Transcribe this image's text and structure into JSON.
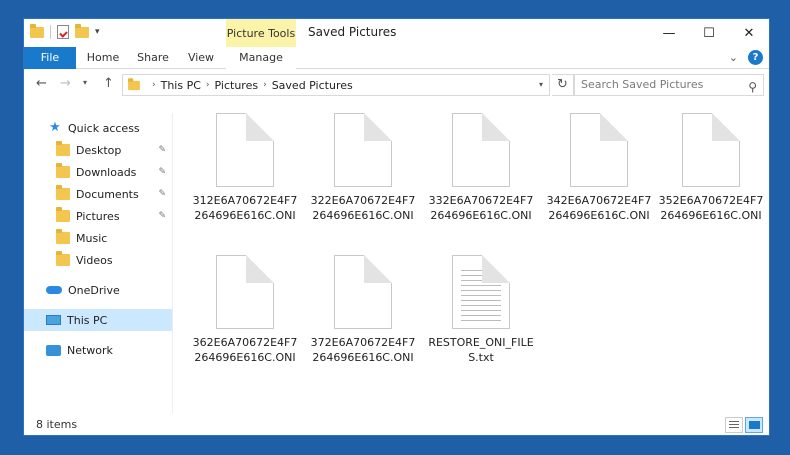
{
  "window": {
    "title": "Saved Pictures",
    "context_tab_group": "Picture Tools",
    "caption": {
      "minimize": "—",
      "maximize": "☐",
      "close": "✕"
    }
  },
  "ribbon": {
    "tabs": [
      "File",
      "Home",
      "Share",
      "View",
      "Manage"
    ],
    "expand_icon": "chevron-down-icon",
    "help_label": "?"
  },
  "navigation": {
    "back": "←",
    "forward": "→",
    "recent": "▾",
    "up": "↑",
    "breadcrumb": [
      "This PC",
      "Pictures",
      "Saved Pictures"
    ],
    "refresh": "↻",
    "search_placeholder": "Search Saved Pictures"
  },
  "sidebar": {
    "items": [
      {
        "label": "Quick access",
        "icon": "star-icon",
        "pinned": false,
        "selected": false
      },
      {
        "label": "Desktop",
        "icon": "folder-icon",
        "pinned": true,
        "selected": false
      },
      {
        "label": "Downloads",
        "icon": "folder-icon",
        "pinned": true,
        "selected": false
      },
      {
        "label": "Documents",
        "icon": "folder-icon",
        "pinned": true,
        "selected": false
      },
      {
        "label": "Pictures",
        "icon": "folder-icon",
        "pinned": true,
        "selected": false
      },
      {
        "label": "Music",
        "icon": "folder-icon",
        "pinned": false,
        "selected": false
      },
      {
        "label": "Videos",
        "icon": "folder-icon",
        "pinned": false,
        "selected": false
      },
      {
        "label": "OneDrive",
        "icon": "cloud-icon",
        "pinned": false,
        "selected": false
      },
      {
        "label": "This PC",
        "icon": "computer-icon",
        "pinned": false,
        "selected": true
      },
      {
        "label": "Network",
        "icon": "network-icon",
        "pinned": false,
        "selected": false
      }
    ],
    "pin_glyph": "📌"
  },
  "files": [
    {
      "name": "312E6A70672E4F7264696E616C.ONI",
      "type": "blank"
    },
    {
      "name": "322E6A70672E4F7264696E616C.ONI",
      "type": "blank"
    },
    {
      "name": "332E6A70672E4F7264696E616C.ONI",
      "type": "blank"
    },
    {
      "name": "342E6A70672E4F7264696E616C.ONI",
      "type": "blank"
    },
    {
      "name": "352E6A70672E4F7264696E616C.ONI",
      "type": "blank"
    },
    {
      "name": "362E6A70672E4F7264696E616C.ONI",
      "type": "blank"
    },
    {
      "name": "372E6A70672E4F7264696E616C.ONI",
      "type": "blank"
    },
    {
      "name": "RESTORE_ONI_FILES.txt",
      "type": "text"
    }
  ],
  "status": {
    "item_count": "8 items"
  },
  "colors": {
    "accent": "#1979ca",
    "context_tab": "#fbf3a8",
    "selection": "#cce8ff",
    "desktop": "#1f5fa8"
  }
}
